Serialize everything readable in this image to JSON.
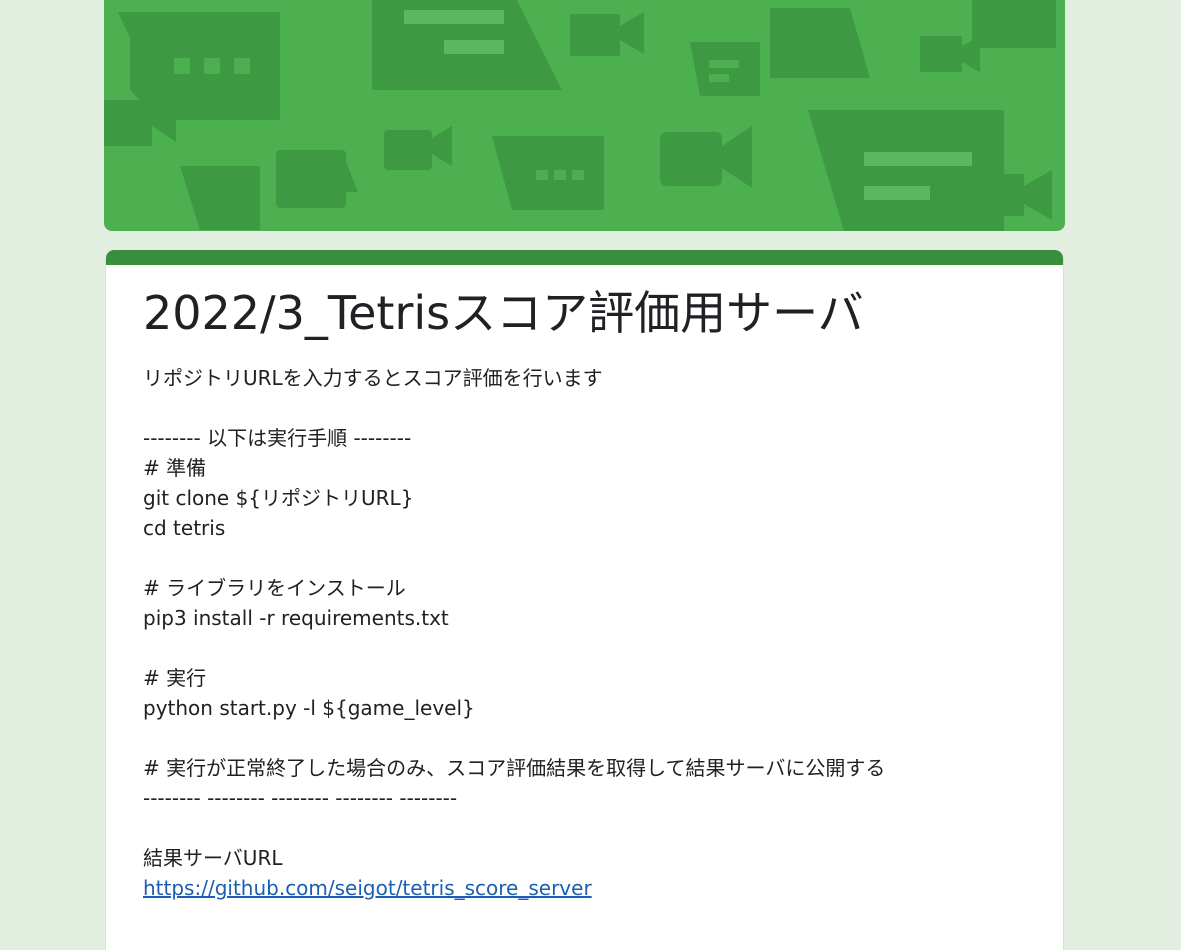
{
  "header": {
    "colors": {
      "banner": "#4caf50",
      "banner_shapes": "#3e9a42",
      "accent_bar": "#388e3c",
      "link": "#1a5fb4"
    }
  },
  "form": {
    "title": "2022/3_Tetrisスコア評価用サーバ",
    "description_lines": [
      "リポジトリURLを入力するとスコア評価を行います",
      "",
      "-------- 以下は実行手順 --------",
      "# 準備",
      "git clone ${リポジトリURL}",
      "cd tetris",
      "",
      "# ライブラリをインストール",
      "pip3 install -r requirements.txt",
      "",
      "# 実行",
      "python start.py -l ${game_level}",
      "",
      "# 実行が正常終了した場合のみ、スコア評価結果を取得して結果サーバに公開する",
      "-------- -------- -------- -------- --------",
      "",
      "結果サーバURL"
    ],
    "link_text": "https://github.com/seigot/tetris_score_server"
  }
}
